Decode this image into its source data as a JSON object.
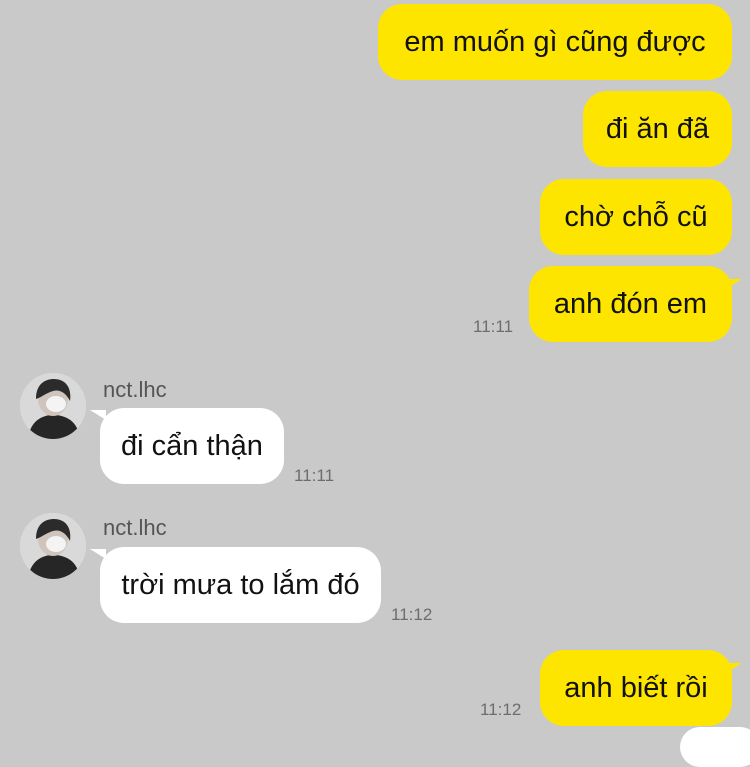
{
  "messages": [
    {
      "direction": "out",
      "text": "em muốn gì cũng được",
      "time": ""
    },
    {
      "direction": "out",
      "text": "đi ăn đã",
      "time": ""
    },
    {
      "direction": "out",
      "text": "chờ chỗ cũ",
      "time": ""
    },
    {
      "direction": "out",
      "text": "anh đón em",
      "time": "11:11"
    },
    {
      "direction": "in",
      "sender": "nct.lhc",
      "text": "đi cẩn thận",
      "time": "11:11"
    },
    {
      "direction": "in",
      "sender": "nct.lhc",
      "text": "trời mưa to lắm đó",
      "time": "11:12"
    },
    {
      "direction": "out",
      "text": "anh biết rồi",
      "time": "11:12"
    }
  ],
  "avatar_icon": "profile-photo-masked-person",
  "colors": {
    "background": "#c9c9c9",
    "outgoing_bubble": "#fde500",
    "incoming_bubble": "#ffffff"
  }
}
